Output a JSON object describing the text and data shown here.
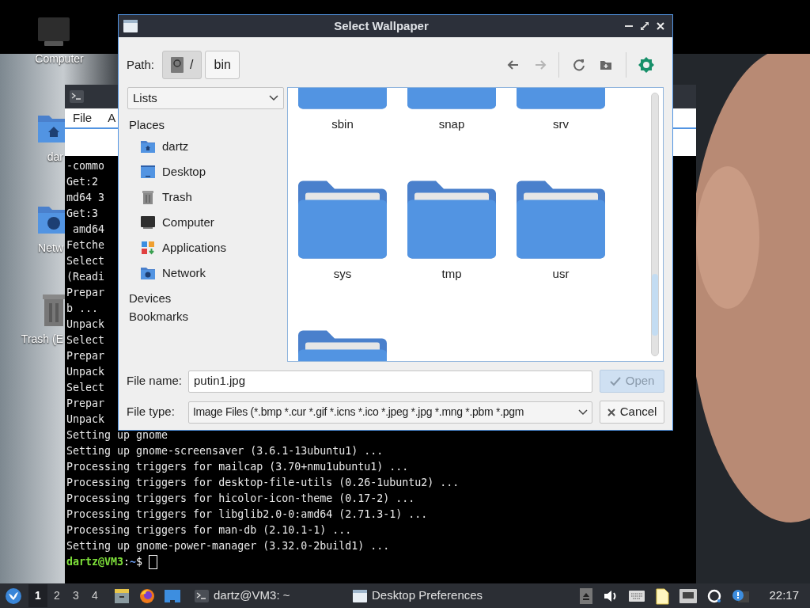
{
  "desktop": {
    "icons": [
      {
        "label": "Computer",
        "kind": "computer"
      },
      {
        "label": "dar",
        "kind": "home"
      },
      {
        "label": "Netw",
        "kind": "network"
      },
      {
        "label": "Trash (E",
        "kind": "trash"
      }
    ]
  },
  "terminal": {
    "menu": [
      "File",
      "A"
    ],
    "lines": [
      "-commo",
      "Get:2",
      "md64 3",
      "Get:3",
      " amd64",
      "Fetche",
      "Select",
      "(Readi",
      "Prepar",
      "b ...",
      "Unpack",
      "Select",
      "Prepar",
      "Unpack",
      "Select",
      "Prepar",
      "Unpack",
      "Setting up gnome",
      "Setting up gnome-screensaver (3.6.1-13ubuntu1) ...",
      "Processing triggers for mailcap (3.70+nmu1ubuntu1) ...",
      "Processing triggers for desktop-file-utils (0.26-1ubuntu2) ...",
      "Processing triggers for hicolor-icon-theme (0.17-2) ...",
      "Processing triggers for libglib2.0-0:amd64 (2.71.3-1) ...",
      "Processing triggers for man-db (2.10.1-1) ...",
      "Setting up gnome-power-manager (3.32.0-2build1) ..."
    ],
    "prompt": {
      "user": "dartz@VM3",
      "separator": ":",
      "path": "~",
      "symbol": "$"
    }
  },
  "dialog": {
    "title": "Select Wallpaper",
    "path_label": "Path:",
    "path_buttons": [
      {
        "label": "/",
        "kind": "root",
        "selected": true
      },
      {
        "label": "bin",
        "kind": "folder",
        "selected": false
      }
    ],
    "toolbar": [
      {
        "kind": "back",
        "disabled": false
      },
      {
        "kind": "forward",
        "disabled": true
      },
      {
        "kind": "reload",
        "disabled": false
      },
      {
        "kind": "new-folder",
        "disabled": false
      },
      {
        "kind": "settings",
        "disabled": false
      }
    ],
    "view_mode": "Lists",
    "sections": [
      {
        "heading": "Places",
        "items": [
          {
            "label": "dartz",
            "kind": "home"
          },
          {
            "label": "Desktop",
            "kind": "desktop"
          },
          {
            "label": "Trash",
            "kind": "trash"
          },
          {
            "label": "Computer",
            "kind": "computer"
          },
          {
            "label": "Applications",
            "kind": "apps"
          },
          {
            "label": "Network",
            "kind": "network"
          }
        ]
      },
      {
        "heading": "Devices"
      },
      {
        "heading": "Bookmarks"
      }
    ],
    "folders": [
      {
        "label": "sbin"
      },
      {
        "label": "snap"
      },
      {
        "label": "srv"
      },
      {
        "label": "sys"
      },
      {
        "label": "tmp"
      },
      {
        "label": "usr"
      }
    ],
    "file_name_label": "File name:",
    "file_name": "putin1.jpg",
    "file_type_label": "File type:",
    "file_type": "Image Files (*.bmp *.cur *.gif *.icns *.ico *.jpeg *.jpg *.mng *.pbm *.pgm",
    "open_button": {
      "label": "Open",
      "disabled": true
    },
    "cancel_button": {
      "label": "Cancel"
    }
  },
  "taskbar": {
    "workspaces": [
      {
        "label": "1",
        "selected": true
      },
      {
        "label": "2",
        "selected": false
      },
      {
        "label": "3",
        "selected": false
      },
      {
        "label": "4",
        "selected": false
      }
    ],
    "tasks": [
      {
        "label": "dartz@VM3: ~",
        "kind": "terminal"
      },
      {
        "label": "Desktop Preferences",
        "kind": "window"
      }
    ],
    "clock": "22:17"
  }
}
